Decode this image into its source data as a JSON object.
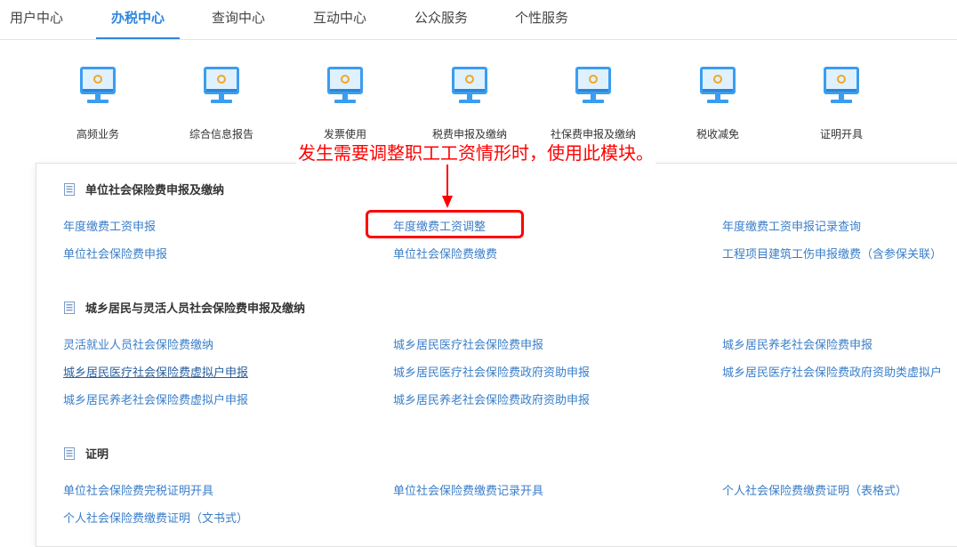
{
  "top_nav": {
    "tabs": [
      {
        "label": "用户中心",
        "active": false
      },
      {
        "label": "办税中心",
        "active": true
      },
      {
        "label": "查询中心",
        "active": false
      },
      {
        "label": "互动中心",
        "active": false
      },
      {
        "label": "公众服务",
        "active": false
      },
      {
        "label": "个性服务",
        "active": false
      }
    ]
  },
  "icon_row": {
    "icon": "monitor-icon",
    "items": [
      {
        "label": "高频业务"
      },
      {
        "label": "综合信息报告"
      },
      {
        "label": "发票使用"
      },
      {
        "label": "税费申报及缴纳"
      },
      {
        "label": "社保费申报及缴纳"
      },
      {
        "label": "税收减免"
      },
      {
        "label": "证明开具"
      }
    ]
  },
  "annotation": {
    "text": "发生需要调整职工工资情形时，使用此模块。",
    "color": "#ff0000"
  },
  "sections": [
    {
      "title": "单位社会保险费申报及缴纳",
      "links": [
        [
          "年度缴费工资申报",
          "年度缴费工资调整",
          "年度缴费工资申报记录查询"
        ],
        [
          "单位社会保险费申报",
          "单位社会保险费缴费",
          "工程项目建筑工伤申报缴费（含参保关联）"
        ]
      ]
    },
    {
      "title": "城乡居民与灵活人员社会保险费申报及缴纳",
      "links": [
        [
          "灵活就业人员社会保险费缴纳",
          "城乡居民医疗社会保险费申报",
          "城乡居民养老社会保险费申报"
        ],
        [
          "城乡居民医疗社会保险费虚拟户申报",
          "城乡居民医疗社会保险费政府资助申报",
          "城乡居民医疗社会保险费政府资助类虚拟户"
        ],
        [
          "城乡居民养老社会保险费虚拟户申报",
          "城乡居民养老社会保险费政府资助申报",
          ""
        ]
      ]
    },
    {
      "title": "证明",
      "links": [
        [
          "单位社会保险费完税证明开具",
          "单位社会保险费缴费记录开具",
          "个人社会保险费缴费证明（表格式）"
        ],
        [
          "个人社会保险费缴费证明（文书式）",
          "",
          ""
        ]
      ]
    }
  ],
  "colors": {
    "accent": "#2e86de",
    "link": "#3a7ec8",
    "annotation": "#ff0000",
    "monitor_blue": "#3b9df0"
  }
}
